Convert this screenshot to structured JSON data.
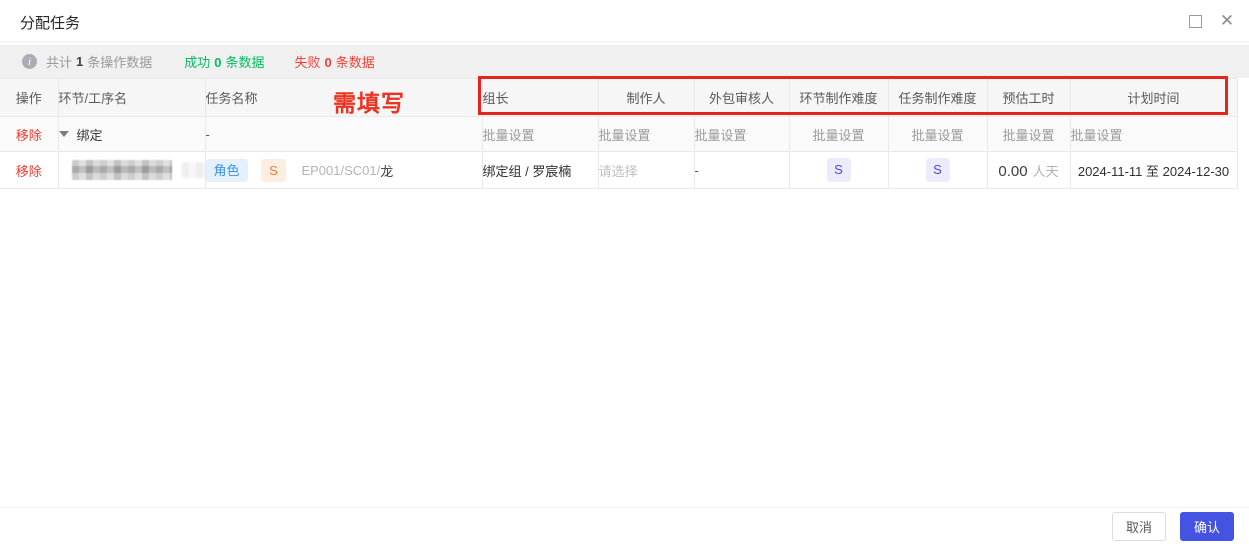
{
  "dialog": {
    "title": "分配任务"
  },
  "summary": {
    "total_prefix": "共计",
    "total_count": "1",
    "total_suffix": "条操作数据",
    "success_prefix": "成功",
    "success_count": "0",
    "success_suffix": "条数据",
    "fail_prefix": "失败",
    "fail_count": "0",
    "fail_suffix": "条数据"
  },
  "annotation": {
    "label": "需填写"
  },
  "table": {
    "headers": [
      "操作",
      "环节/工序名",
      "任务名称",
      "组长",
      "制作人",
      "外包审核人",
      "环节制作难度",
      "任务制作难度",
      "预估工时",
      "计划时间"
    ],
    "batch_row": {
      "remove_label": "移除",
      "group_label": "绑定",
      "task_name": "-",
      "batch_label": "批量设置"
    },
    "task_row": {
      "remove_label": "移除",
      "type_badge": "角色",
      "level_badge": "S",
      "task_path": "EP001/SC01/",
      "task_name_last": "龙",
      "leader": "绑定组 / 罗宸楠",
      "producer_placeholder": "请选择",
      "outsource_reviewer": "-",
      "stage_difficulty": "S",
      "task_difficulty": "S",
      "estimate_value": "0.00",
      "estimate_unit": "人天",
      "plan_time": "2024-11-11 至 2024-12-30"
    }
  },
  "footer": {
    "cancel_label": "取消",
    "confirm_label": "确认"
  },
  "colors": {
    "accent": "#4553e3",
    "success": "#00bf60",
    "danger": "#f53f36",
    "annotation_red": "#e4251b",
    "type_badge_blue": "#3e90e8",
    "level_badge_orange": "#ee7c2f",
    "difficulty_purple": "#4b48e5"
  },
  "icons": {
    "info": "info-icon",
    "maximize": "maximize-icon",
    "close": "close-icon",
    "collapse": "chevron-down-icon"
  }
}
